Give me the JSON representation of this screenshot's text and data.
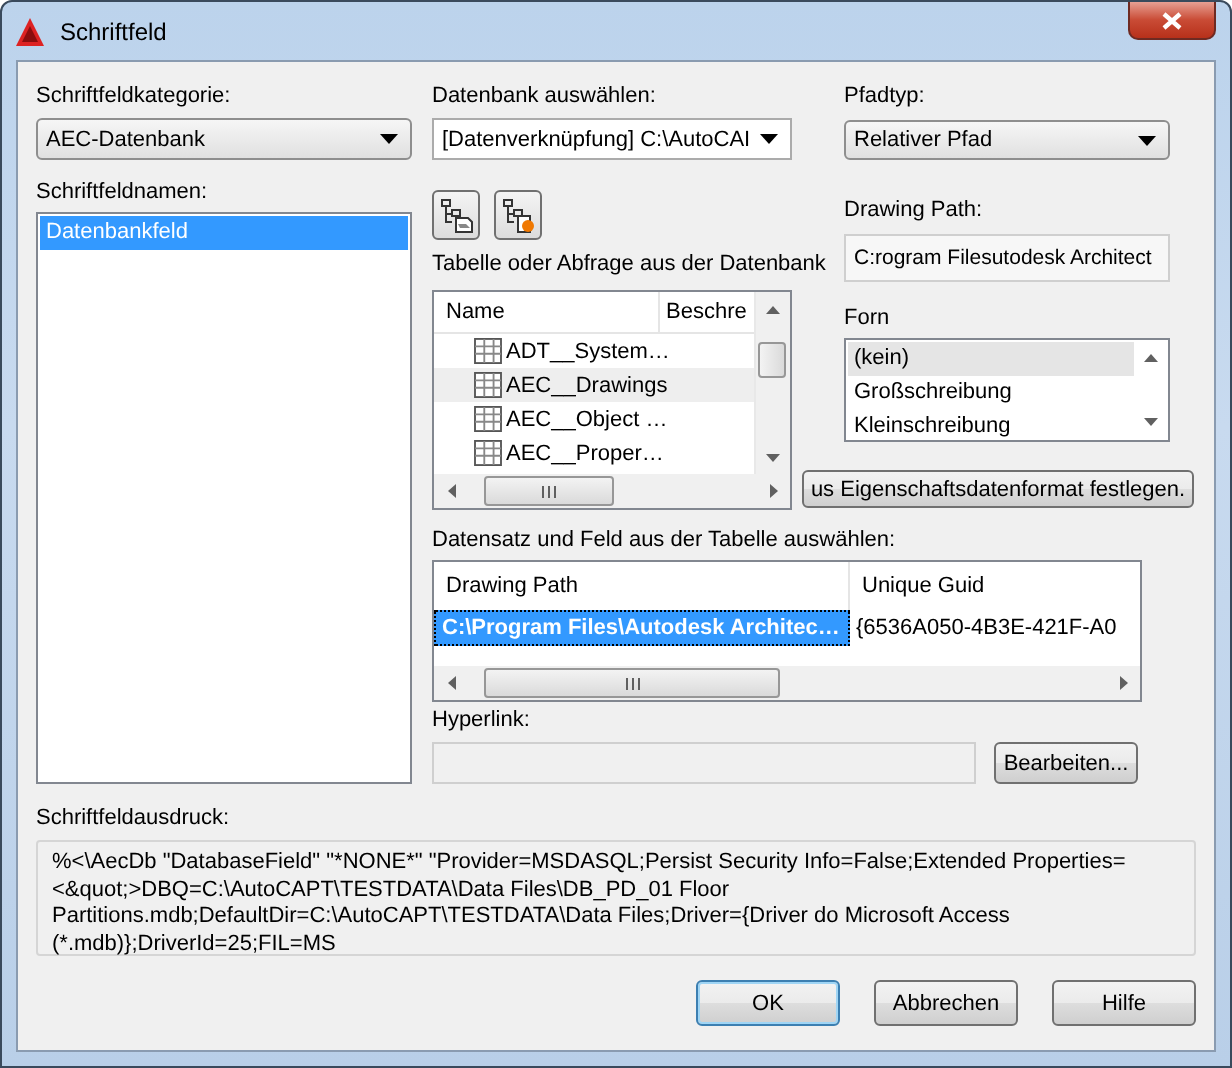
{
  "window": {
    "title": "Schriftfeld"
  },
  "category": {
    "label": "Schriftfeldkategorie:",
    "value": "AEC-Datenbank"
  },
  "field_names": {
    "label": "Schriftfeldnamen:",
    "items": [
      {
        "label": "Datenbankfeld",
        "selected": true
      }
    ]
  },
  "database": {
    "label": "Datenbank auswählen:",
    "value": "[Datenverknüpfung] C:\\AutoCAI"
  },
  "path_type": {
    "label": "Pfadtyp:",
    "value": "Relativer Pfad"
  },
  "drawing_path": {
    "label": "Drawing Path:",
    "value": "C:rogram Filesutodesk Architect"
  },
  "tables": {
    "label": "Tabelle oder Abfrage aus der Datenbank",
    "columns": [
      "Name",
      "Beschre"
    ],
    "rows": [
      {
        "name": "ADT__System…",
        "selected": false
      },
      {
        "name": "AEC__Drawings",
        "selected": true
      },
      {
        "name": "AEC__Object …",
        "selected": false
      },
      {
        "name": "AEC__Proper…",
        "selected": false
      }
    ]
  },
  "format": {
    "label": "Forn",
    "items": [
      {
        "label": "(kein)",
        "selected": true
      },
      {
        "label": "Großschreibung",
        "selected": false
      },
      {
        "label": "Kleinschreibung",
        "selected": false
      }
    ],
    "button": "us Eigenschaftsdatenformat festlegen."
  },
  "records": {
    "label": "Datensatz und Feld aus der Tabelle auswählen:",
    "columns": [
      "Drawing Path",
      "Unique Guid"
    ],
    "rows": [
      {
        "cells": [
          "C:\\Program Files\\Autodesk Architec…",
          "{6536A050-4B3E-421F-A0"
        ],
        "selected": true
      }
    ]
  },
  "hyperlink": {
    "label": "Hyperlink:",
    "disabled": true,
    "button": "Bearbeiten..."
  },
  "expression": {
    "label": "Schriftfeldausdruck:",
    "text": "%<\\AecDb \"DatabaseField\" \"*NONE*\" \"Provider=MSDASQL;Persist Security Info=False;Extended Properties=<&quot;>DBQ=C:\\AutoCAPT\\TESTDATA\\Data Files\\DB_PD_01 Floor Partitions.mdb;DefaultDir=C:\\AutoCAPT\\TESTDATA\\Data Files;Driver={Driver do Microsoft Access (*.mdb)};DriverId=25;FIL=MS"
  },
  "buttons": [
    {
      "label": "OK",
      "default": true
    },
    {
      "label": "Abbrechen",
      "default": false
    },
    {
      "label": "Hilfe",
      "default": false
    }
  ]
}
